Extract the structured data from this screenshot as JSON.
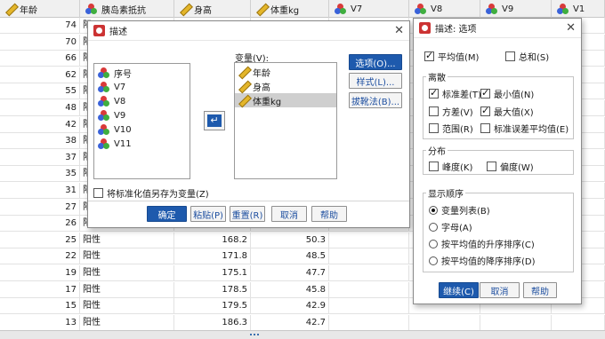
{
  "sheet": {
    "headers": [
      {
        "icon": "ruler-icon",
        "label": "年龄"
      },
      {
        "icon": "balls-icon",
        "label": "胰岛素抵抗"
      },
      {
        "icon": "ruler-icon",
        "label": "身高"
      },
      {
        "icon": "ruler-icon",
        "label": "体重kg"
      },
      {
        "icon": "balls-icon",
        "label": "V7"
      },
      {
        "icon": "balls-icon",
        "label": "V8"
      },
      {
        "icon": "balls-icon",
        "label": "V9"
      },
      {
        "icon": "balls-icon",
        "label": "V1"
      }
    ],
    "rows": [
      {
        "age": "74",
        "ir": "阳",
        "height": "",
        "weight": ""
      },
      {
        "age": "70",
        "ir": "阳",
        "height": "",
        "weight": ""
      },
      {
        "age": "66",
        "ir": "阳",
        "height": "",
        "weight": ""
      },
      {
        "age": "62",
        "ir": "阳",
        "height": "",
        "weight": ""
      },
      {
        "age": "55",
        "ir": "阳",
        "height": "",
        "weight": ""
      },
      {
        "age": "48",
        "ir": "阳",
        "height": "",
        "weight": ""
      },
      {
        "age": "42",
        "ir": "阳",
        "height": "",
        "weight": ""
      },
      {
        "age": "38",
        "ir": "阳",
        "height": "",
        "weight": ""
      },
      {
        "age": "37",
        "ir": "阳",
        "height": "",
        "weight": ""
      },
      {
        "age": "35",
        "ir": "阳",
        "height": "",
        "weight": ""
      },
      {
        "age": "31",
        "ir": "阳",
        "height": "",
        "weight": ""
      },
      {
        "age": "27",
        "ir": "阳",
        "height": "",
        "weight": ""
      },
      {
        "age": "26",
        "ir": "阳",
        "height": "",
        "weight": ""
      },
      {
        "age": "25",
        "ir": "阳性",
        "height": "168.2",
        "weight": "50.3"
      },
      {
        "age": "22",
        "ir": "阳性",
        "height": "171.8",
        "weight": "48.5"
      },
      {
        "age": "19",
        "ir": "阳性",
        "height": "175.1",
        "weight": "47.7"
      },
      {
        "age": "17",
        "ir": "阳性",
        "height": "178.5",
        "weight": "45.8"
      },
      {
        "age": "15",
        "ir": "阳性",
        "height": "179.5",
        "weight": "42.9"
      },
      {
        "age": "13",
        "ir": "阳性",
        "height": "186.3",
        "weight": "42.7"
      }
    ]
  },
  "describe_dialog": {
    "title": "描述",
    "source_vars": [
      {
        "icon": "balls-icon",
        "label": "序号"
      },
      {
        "icon": "balls-icon",
        "label": "V7"
      },
      {
        "icon": "balls-icon",
        "label": "V8"
      },
      {
        "icon": "balls-icon",
        "label": "V9"
      },
      {
        "icon": "balls-icon",
        "label": "V10"
      },
      {
        "icon": "balls-icon",
        "label": "V11"
      }
    ],
    "target_label": "变量(V):",
    "target_vars": [
      {
        "icon": "ruler-icon",
        "label": "年龄",
        "selected": false
      },
      {
        "icon": "ruler-icon",
        "label": "身高",
        "selected": false
      },
      {
        "icon": "ruler-icon",
        "label": "体重kg",
        "selected": true
      }
    ],
    "side_buttons": [
      "选项(O)...",
      "样式(L)...",
      "拔靴法(B)..."
    ],
    "save_std_label": "将标准化值另存为变量(Z)",
    "save_std_checked": false,
    "bottom_buttons": [
      "确定",
      "粘贴(P)",
      "重置(R)",
      "取消",
      "帮助"
    ]
  },
  "options_dialog": {
    "title": "描述: 选项",
    "mean": {
      "label": "平均值(M)",
      "checked": true
    },
    "sum": {
      "label": "总和(S)",
      "checked": false
    },
    "dispersion": {
      "title": "离散",
      "items": [
        {
          "label": "标准差(T)",
          "checked": true
        },
        {
          "label": "最小值(N)",
          "checked": true
        },
        {
          "label": "方差(V)",
          "checked": false
        },
        {
          "label": "最大值(X)",
          "checked": true
        },
        {
          "label": "范围(R)",
          "checked": false
        },
        {
          "label": "标准误差平均值(E)",
          "checked": false
        }
      ]
    },
    "distribution": {
      "title": "分布",
      "items": [
        {
          "label": "峰度(K)",
          "checked": false
        },
        {
          "label": "偏度(W)",
          "checked": false
        }
      ]
    },
    "display_order": {
      "title": "显示顺序",
      "items": [
        {
          "label": "变量列表(B)",
          "checked": true
        },
        {
          "label": "字母(A)",
          "checked": false
        },
        {
          "label": "按平均值的升序排序(C)",
          "checked": false
        },
        {
          "label": "按平均值的降序排序(D)",
          "checked": false
        }
      ]
    },
    "buttons": [
      "继续(C)",
      "取消",
      "帮助"
    ]
  }
}
